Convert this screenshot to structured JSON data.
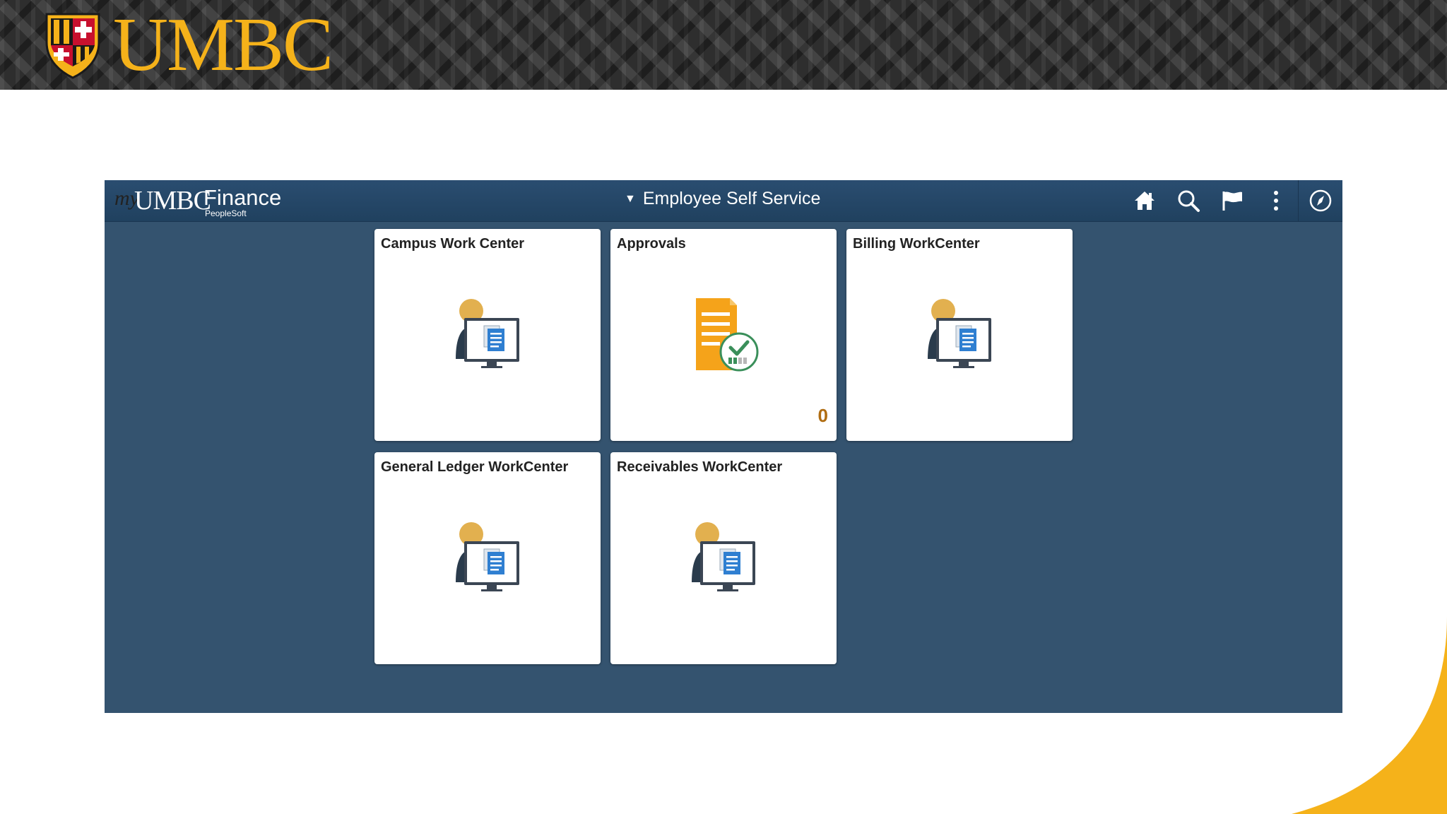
{
  "banner": {
    "logo_text": "UMBC"
  },
  "app": {
    "brand": {
      "prefix": "my",
      "name": "UMBC",
      "product": "Finance",
      "sub": "PeopleSoft"
    },
    "header": {
      "nav_title": "Employee Self Service",
      "icons": [
        "home-icon",
        "search-icon",
        "flag-icon",
        "more-vertical-icon",
        "compass-icon"
      ]
    },
    "tiles": [
      {
        "title": "Campus Work Center",
        "icon": "workcenter-person-monitor-icon"
      },
      {
        "title": "Approvals",
        "icon": "approval-document-check-icon",
        "count": "0"
      },
      {
        "title": "Billing WorkCenter",
        "icon": "workcenter-person-monitor-icon"
      },
      {
        "title": "General Ledger WorkCenter",
        "icon": "workcenter-person-monitor-icon"
      },
      {
        "title": "Receivables WorkCenter",
        "icon": "workcenter-person-monitor-icon"
      }
    ]
  },
  "colors": {
    "brand_gold": "#f5b21a",
    "app_background": "#34536f",
    "header_background": "#20415f",
    "count_color": "#b06d12"
  }
}
